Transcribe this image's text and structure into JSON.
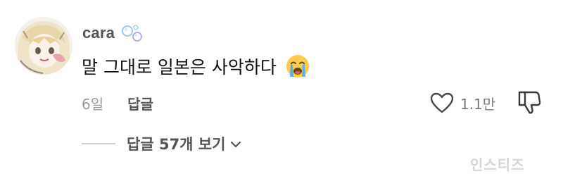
{
  "comment": {
    "username": "cara",
    "text": "말 그대로 일본은 사악하다",
    "emoji_name": "loudly-crying-face",
    "time_ago": "6일",
    "reply_label": "답글",
    "like_count": "1.1만",
    "view_replies_label": "답글 57개 보기"
  },
  "watermark_text": "인스티즈",
  "icons": {
    "badge": "bubbles-icon",
    "like": "heart-outline-icon",
    "dislike": "thumbs-down-outline-icon",
    "expand": "chevron-down-icon"
  },
  "colors": {
    "username": "#555555",
    "text": "#111111",
    "muted": "#9a9a9a",
    "divider": "#cfcfcf"
  }
}
